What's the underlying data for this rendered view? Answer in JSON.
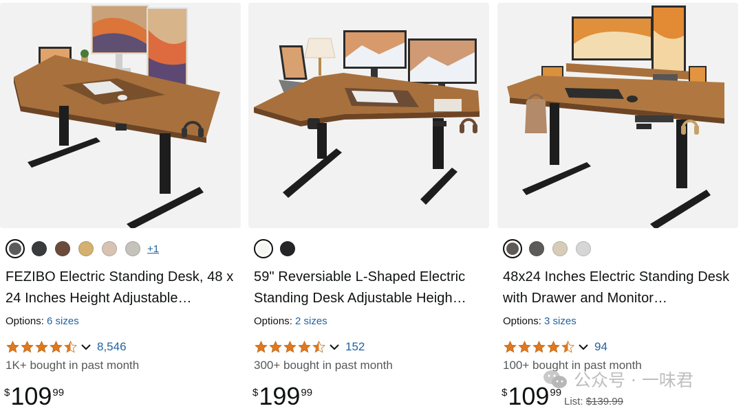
{
  "products": [
    {
      "title": "FEZIBO Electric Standing Desk, 48 x 24 Inches Height Adjustable…",
      "swatches": [
        "#5b5b5e",
        "#3a3b3f",
        "#6b4c3c",
        "#d4b071",
        "#d6c3b3",
        "#c5c2bc"
      ],
      "more_colors": "+1",
      "options_label": "Options:",
      "options_link": "6 sizes",
      "rating": 4.5,
      "rating_count": "8,546",
      "bought": "1K+ bought in past month",
      "price_symbol": "$",
      "price_whole": "109",
      "price_fraction": "99"
    },
    {
      "title": "59\" Reversiable L-Shaped Electric Standing Desk Adjustable Heigh…",
      "swatches": [
        "#f7f5f2",
        "#252527"
      ],
      "options_label": "Options:",
      "options_link": "2 sizes",
      "rating": 4.5,
      "rating_count": "152",
      "bought": "300+ bought in past month",
      "price_symbol": "$",
      "price_whole": "199",
      "price_fraction": "99"
    },
    {
      "title": "48x24 Inches Electric Standing Desk with Drawer and Monitor…",
      "swatches": [
        "#5f5a55",
        "#5e5a58",
        "#d6cdb8",
        "#d6d6d6"
      ],
      "options_label": "Options:",
      "options_link": "3 sizes",
      "rating": 4.5,
      "rating_count": "94",
      "bought": "100+ bought in past month",
      "price_symbol": "$",
      "price_whole": "109",
      "price_fraction": "99",
      "list_label": "List:",
      "list_price": "$139.99"
    }
  ],
  "watermark": {
    "text": "公众号 · 一味君",
    "icon": "wechat-icon"
  },
  "colors": {
    "link": "#2162a1",
    "star": "#de7921",
    "desk_top": "#a8703c"
  }
}
